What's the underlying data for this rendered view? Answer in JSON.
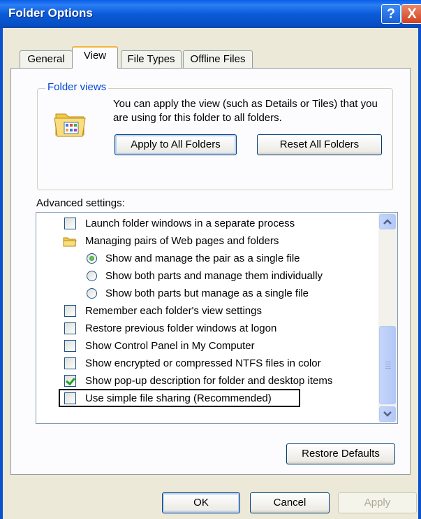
{
  "window": {
    "title": "Folder Options",
    "help_label": "?",
    "close_label": "X"
  },
  "tabs": [
    {
      "label": "General",
      "active": false
    },
    {
      "label": "View",
      "active": true
    },
    {
      "label": "File Types",
      "active": false
    },
    {
      "label": "Offline Files",
      "active": false
    }
  ],
  "folder_views": {
    "legend": "Folder views",
    "description": "You can apply the view (such as Details or Tiles) that you are using for this folder to all folders.",
    "apply_label": "Apply to All Folders",
    "reset_label": "Reset All Folders"
  },
  "advanced": {
    "label": "Advanced settings:",
    "items": [
      {
        "type": "checkbox",
        "checked": false,
        "indent": 0,
        "label": "Launch folder windows in a separate process"
      },
      {
        "type": "folder",
        "indent": 0,
        "label": "Managing pairs of Web pages and folders"
      },
      {
        "type": "radio",
        "checked": true,
        "indent": 1,
        "label": "Show and manage the pair as a single file"
      },
      {
        "type": "radio",
        "checked": false,
        "indent": 1,
        "label": "Show both parts and manage them individually"
      },
      {
        "type": "radio",
        "checked": false,
        "indent": 1,
        "label": "Show both parts but manage as a single file"
      },
      {
        "type": "checkbox",
        "checked": false,
        "indent": 0,
        "label": "Remember each folder's view settings"
      },
      {
        "type": "checkbox",
        "checked": false,
        "indent": 0,
        "label": "Restore previous folder windows at logon"
      },
      {
        "type": "checkbox",
        "checked": false,
        "indent": 0,
        "label": "Show Control Panel in My Computer"
      },
      {
        "type": "checkbox",
        "checked": false,
        "indent": 0,
        "label": "Show encrypted or compressed NTFS files in color"
      },
      {
        "type": "checkbox",
        "checked": true,
        "indent": 0,
        "label": "Show pop-up description for folder and desktop items"
      },
      {
        "type": "checkbox",
        "checked": false,
        "indent": 0,
        "label": "Use simple file sharing (Recommended)"
      }
    ],
    "restore_defaults_label": "Restore Defaults"
  },
  "footer": {
    "ok_label": "OK",
    "cancel_label": "Cancel",
    "apply_label": "Apply"
  },
  "colors": {
    "titlebar": "#0a5bd8",
    "legend_text": "#0046d5",
    "dialog_bg": "#ece9d8"
  }
}
